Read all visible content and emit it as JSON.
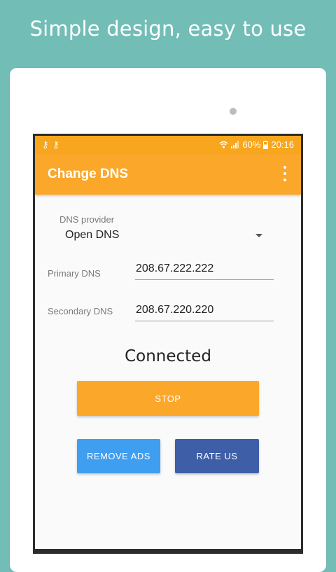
{
  "headline": "Simple design, easy to use",
  "status_bar": {
    "left_icons": "⚷ ⚷",
    "signal_icons": "📶",
    "battery": "60%",
    "time": "20:16"
  },
  "app_bar": {
    "title": "Change DNS"
  },
  "form": {
    "provider_label": "DNS provider",
    "provider_value": "Open DNS",
    "primary_label": "Primary DNS",
    "primary_value": "208.67.222.222",
    "secondary_label": "Secondary DNS",
    "secondary_value": "208.67.220.220"
  },
  "connection_status": "Connected",
  "buttons": {
    "stop": "STOP",
    "remove_ads": "REMOVE ADS",
    "rate_us": "RATE US"
  },
  "colors": {
    "background": "#72bdb6",
    "app_bar": "#fba72a",
    "stop_button": "#fba72a",
    "remove_ads_button": "#3f9ef0",
    "rate_us_button": "#3f5ea8"
  }
}
